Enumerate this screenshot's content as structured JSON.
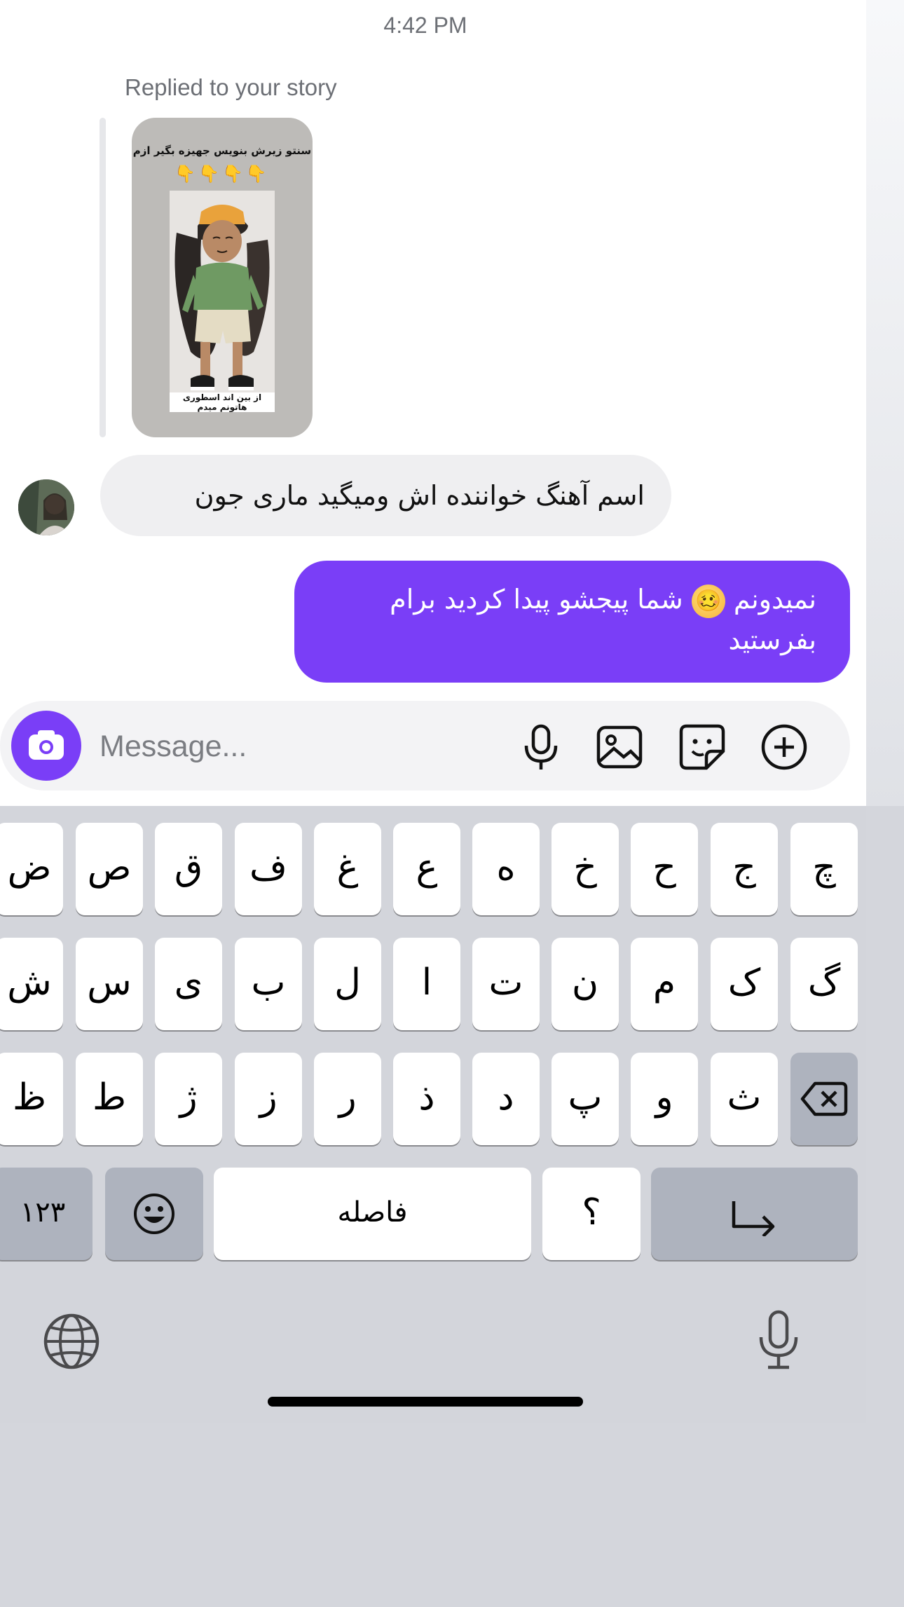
{
  "status": {
    "time": "4:42 PM"
  },
  "story_reply": {
    "label": "Replied to your story",
    "caption_top": "سنتو زیرش بنویس جهیزه بگیر ازم",
    "hands": "👇👇👇👇",
    "caption_bottom": "از بین اند اسطوری هاتونم میدم"
  },
  "messages": {
    "incoming": "اسم آهنگ خواننده اش ومیگید ماری جون",
    "outgoing_before_emoji": "نمیدونم ",
    "outgoing_emoji": "🥴",
    "outgoing_after_emoji": " شما پیجشو پیدا کردید برام بفرستید"
  },
  "composer": {
    "placeholder": "Message...",
    "icons": [
      "camera-icon",
      "microphone-icon",
      "gallery-icon",
      "sticker-icon",
      "plus-icon"
    ]
  },
  "keyboard": {
    "row1": [
      "ض",
      "ص",
      "ق",
      "ف",
      "غ",
      "ع",
      "ه",
      "خ",
      "ح",
      "ج",
      "چ"
    ],
    "row2": [
      "ش",
      "س",
      "ی",
      "ب",
      "ل",
      "ا",
      "ت",
      "ن",
      "م",
      "ک",
      "گ"
    ],
    "row3": [
      "ظ",
      "ط",
      "ژ",
      "ز",
      "ر",
      "ذ",
      "د",
      "پ",
      "و",
      "ث"
    ],
    "numbers_label": "۱۲۳",
    "space_label": "فاصله",
    "punct_label": "؟",
    "icons": [
      "backspace-icon",
      "emoji-icon",
      "return-icon",
      "globe-icon",
      "dictation-icon"
    ]
  },
  "colors": {
    "accent": "#7a3ef7",
    "incoming_bubble": "#efeff1",
    "keyboard_bg": "#d3d5db"
  }
}
